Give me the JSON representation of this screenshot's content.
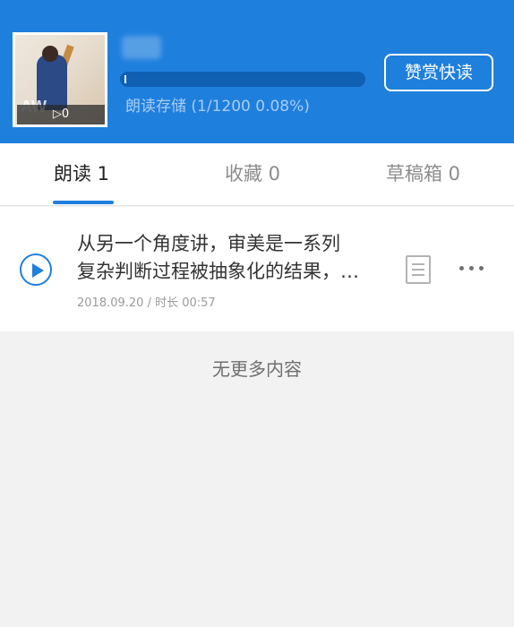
{
  "header": {
    "username": "某某",
    "cover_play_count": "▷0",
    "storage_text": "朗读存储 (1/1200 0.08%)",
    "storage_progress_percent": 0.08,
    "reward_button": "赞赏快读"
  },
  "tabs": [
    {
      "label": "朗读 1",
      "active": true
    },
    {
      "label": "收藏 0",
      "active": false
    },
    {
      "label": "草稿箱 0",
      "active": false
    }
  ],
  "items": [
    {
      "title_line1": "从另一个角度讲，审美是一系列",
      "title_line2": "复杂判断过程被抽象化的结果，…",
      "meta": "2018.09.20 / 时长 00:57"
    }
  ],
  "footer": {
    "no_more": "无更多内容"
  },
  "colors": {
    "brand_blue": "#1f7fdd",
    "progress_track": "#0f5fb3"
  },
  "icons": {
    "play": "play-circle-icon",
    "document": "document-icon",
    "more": "more-dots-icon"
  }
}
